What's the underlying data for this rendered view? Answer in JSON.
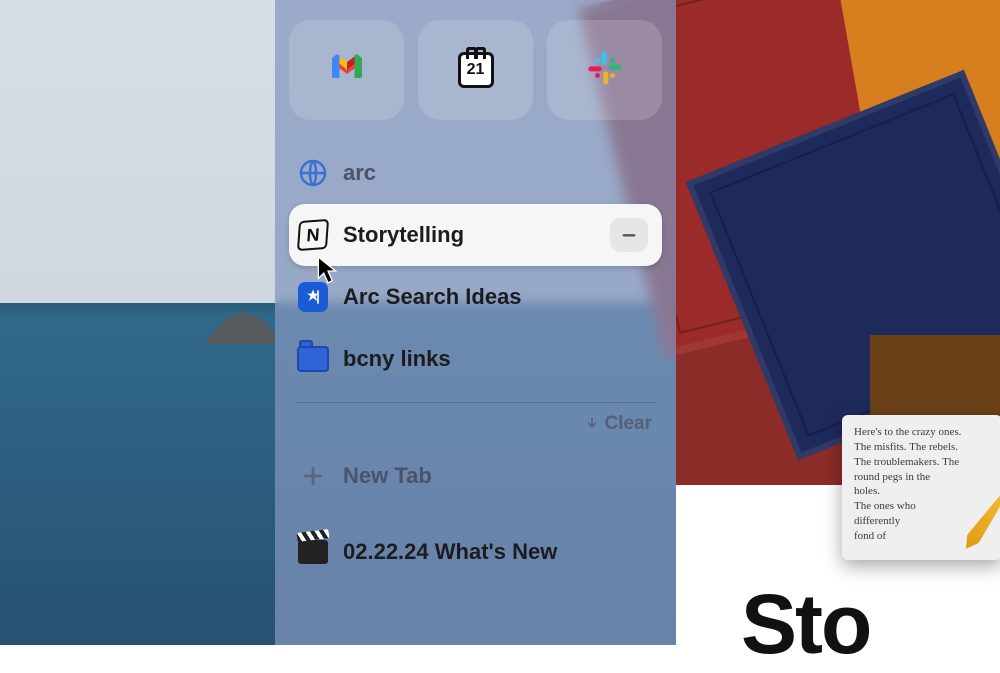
{
  "pinned_apps": [
    {
      "name": "gmail"
    },
    {
      "name": "calendar",
      "badge": "21"
    },
    {
      "name": "slack"
    }
  ],
  "tabs": [
    {
      "id": "arc",
      "label": "arc",
      "icon": "globe",
      "style": "muted"
    },
    {
      "id": "story",
      "label": "Storytelling",
      "icon": "notion",
      "style": "selected"
    },
    {
      "id": "arc-search",
      "label": "Arc Search Ideas",
      "icon": "star-doc",
      "style": "normal"
    },
    {
      "id": "bcny",
      "label": "bcny links",
      "icon": "folder",
      "style": "bold"
    }
  ],
  "clear_label": "Clear",
  "new_tab_label": "New Tab",
  "recent_tab_label": "02.22.24 What's New",
  "page_title_fragment": "Sto",
  "sticky_note_lines": [
    "Here's to the crazy ones.",
    "The misfits. The rebels.",
    "The troublemakers. The",
    "round pegs in the",
    "holes.",
    "The ones who",
    "differently",
    "fond of"
  ]
}
